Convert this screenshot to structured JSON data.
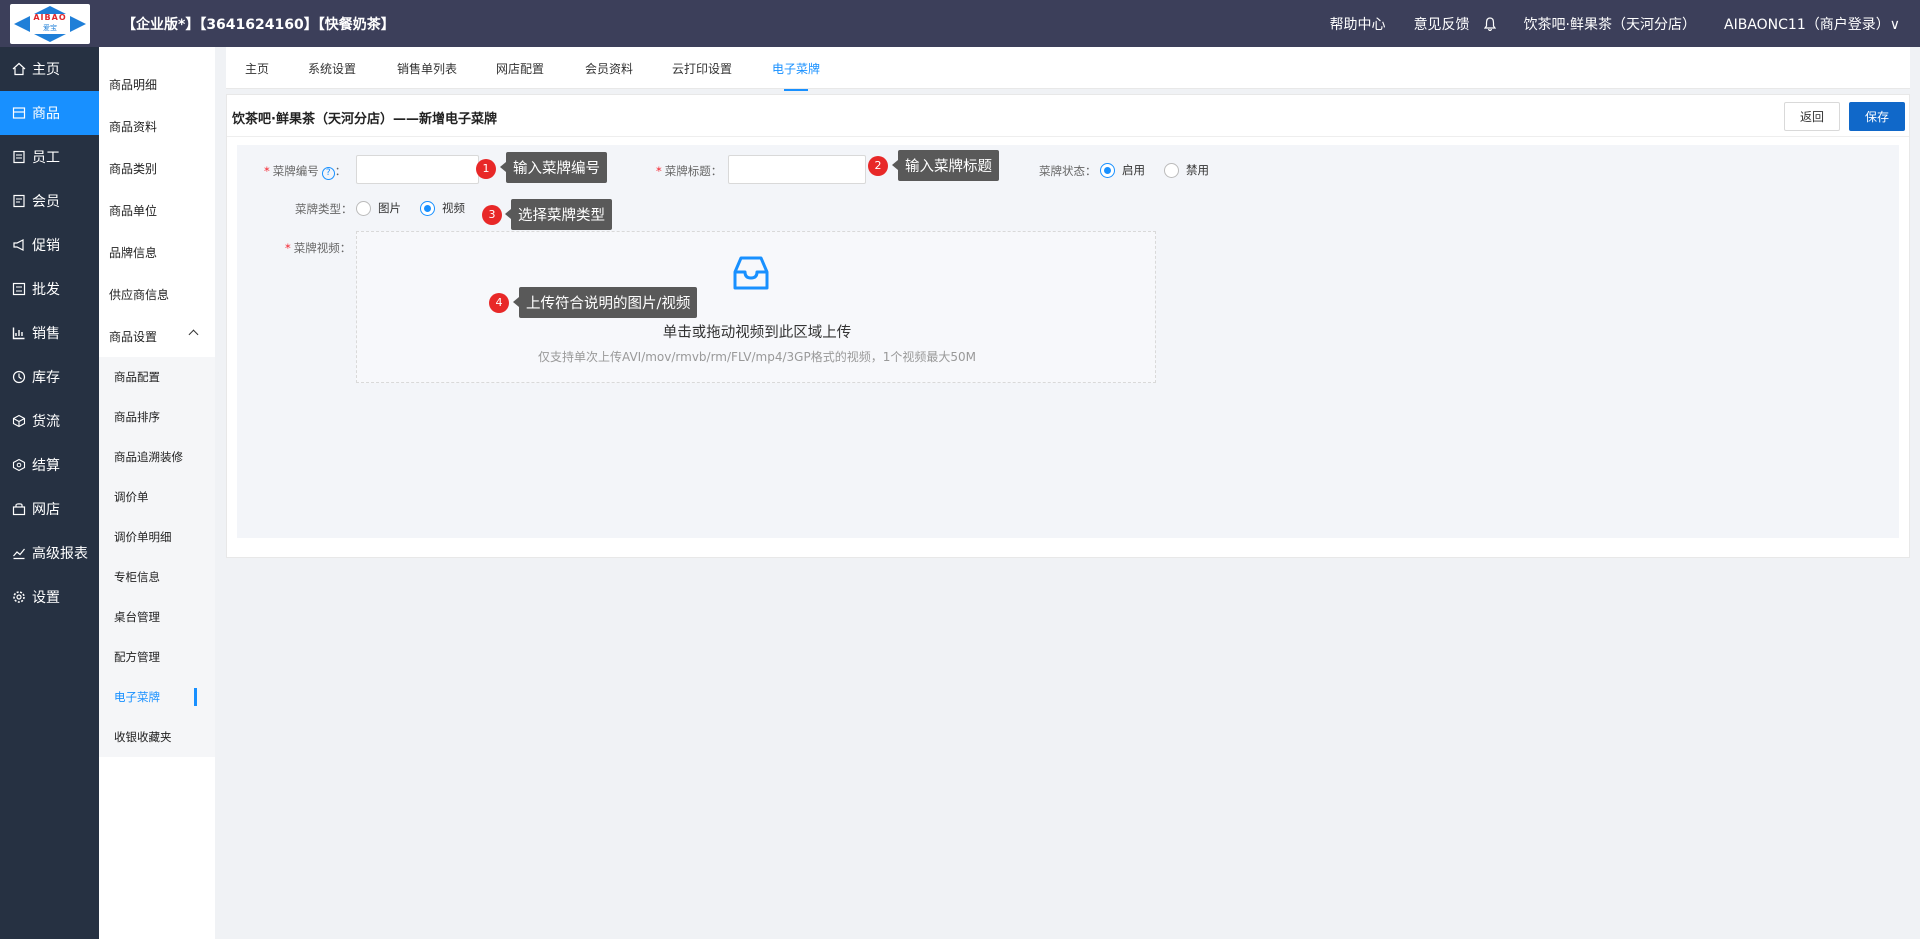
{
  "header": {
    "logo_text": "AIBAO",
    "logo_subtext": "爱宝",
    "company": "【企业版*】【3641624160】【快餐奶茶】",
    "help": "帮助中心",
    "feedback": "意见反馈",
    "store": "饮茶吧·鲜果茶（天河分店）",
    "user": "AIBAONC11（商户登录）∨"
  },
  "leftnav": [
    {
      "label": "主页",
      "icon": "home-icon"
    },
    {
      "label": "商品",
      "icon": "goods-icon",
      "active": true
    },
    {
      "label": "员工",
      "icon": "staff-icon"
    },
    {
      "label": "会员",
      "icon": "member-icon"
    },
    {
      "label": "促销",
      "icon": "promo-icon"
    },
    {
      "label": "批发",
      "icon": "wholesale-icon"
    },
    {
      "label": "销售",
      "icon": "sales-icon"
    },
    {
      "label": "库存",
      "icon": "stock-icon"
    },
    {
      "label": "货流",
      "icon": "logistics-icon"
    },
    {
      "label": "结算",
      "icon": "settle-icon"
    },
    {
      "label": "网店",
      "icon": "shop-icon"
    },
    {
      "label": "高级报表",
      "icon": "report-icon"
    },
    {
      "label": "设置",
      "icon": "settings-icon"
    }
  ],
  "subnav": {
    "items": [
      "商品明细",
      "商品资料",
      "商品类别",
      "商品单位",
      "品牌信息",
      "供应商信息"
    ],
    "group": "商品设置",
    "children": [
      "商品配置",
      "商品排序",
      "商品追溯装修",
      "调价单",
      "调价单明细",
      "专柜信息",
      "桌台管理",
      "配方管理",
      "电子菜牌",
      "收银收藏夹"
    ],
    "selected_child": "电子菜牌"
  },
  "tabs": [
    "主页",
    "系统设置",
    "销售单列表",
    "网店配置",
    "会员资料",
    "云打印设置",
    "电子菜牌"
  ],
  "active_tab": "电子菜牌",
  "panel": {
    "title": "饮茶吧·鲜果茶（天河分店）——新增电子菜牌",
    "back": "返回",
    "save": "保存"
  },
  "form": {
    "code_label": "菜牌编号",
    "code_value": "",
    "title_label": "菜牌标题",
    "title_value": "",
    "status_label": "菜牌状态：",
    "status_options": [
      "启用",
      "禁用"
    ],
    "status_selected": "启用",
    "type_label": "菜牌类型：",
    "type_options": [
      "图片",
      "视频"
    ],
    "type_selected": "视频",
    "video_label": "菜牌视频：",
    "upload_main": "单击或拖动视频到此区域上传",
    "upload_sub": "仅支持单次上传AVI/mov/rmvb/rm/FLV/mp4/3GP格式的视频，1个视频最大50M"
  },
  "tips": [
    {
      "num": "1",
      "text": "输入菜牌编号"
    },
    {
      "num": "2",
      "text": "输入菜牌标题"
    },
    {
      "num": "3",
      "text": "选择菜牌类型"
    },
    {
      "num": "4",
      "text": "上传符合说明的图片/视频"
    }
  ],
  "colors": {
    "accent": "#1890ff",
    "topbar": "#3c3f5a",
    "sidebar": "#263142",
    "save": "#1068c9"
  }
}
